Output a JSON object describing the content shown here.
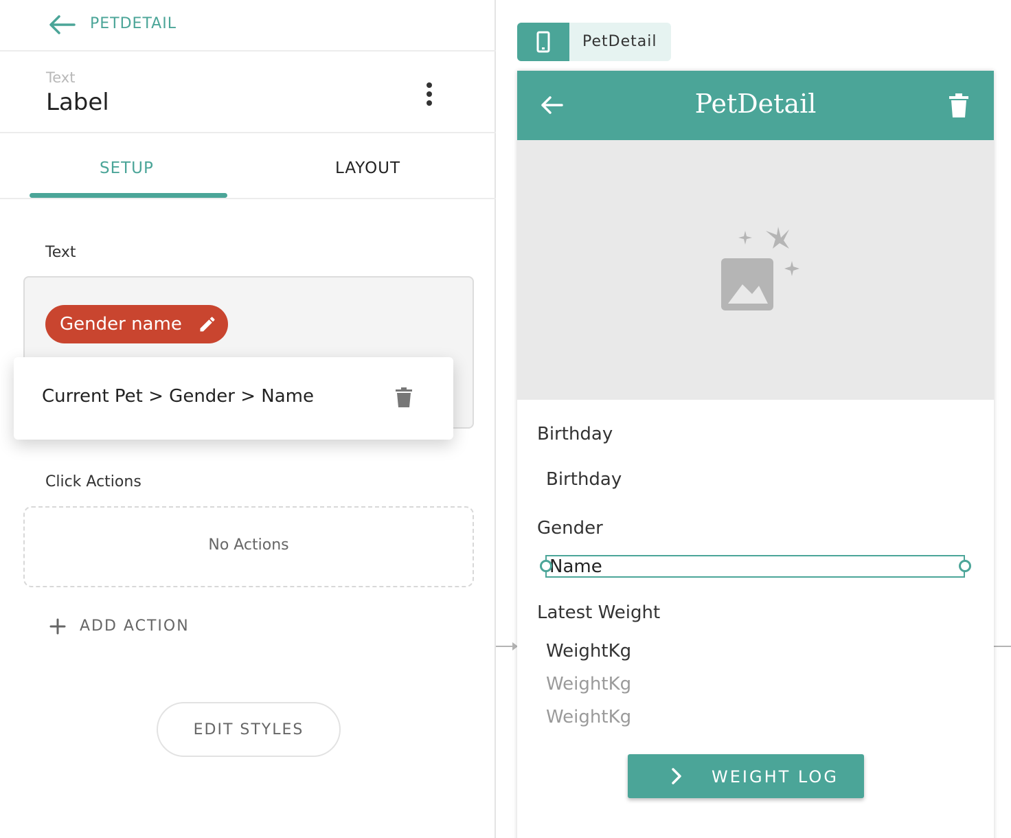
{
  "colors": {
    "accent": "#4ba598",
    "chip": "#c9452f",
    "image_bg": "#e9e9e9"
  },
  "left_panel": {
    "back": {
      "icon": "arrow-left-icon",
      "title": "PETDETAIL"
    },
    "component": {
      "type": "Text",
      "name": "Label",
      "menu_icon": "more-vertical-icon"
    },
    "tabs": [
      {
        "label": "SETUP",
        "active": true
      },
      {
        "label": "LAYOUT",
        "active": false
      }
    ],
    "text_section": {
      "label": "Text",
      "chip": {
        "label": "Gender name",
        "icon": "pencil-icon"
      },
      "binding_path": "Current Pet > Gender > Name",
      "delete_icon": "trash-icon"
    },
    "click_actions": {
      "label": "Click Actions",
      "empty_text": "No Actions",
      "add_label": "ADD ACTION",
      "add_icon": "plus-icon"
    },
    "edit_styles_label": "EDIT STYLES"
  },
  "canvas": {
    "screen_tag": {
      "icon": "phone-icon",
      "label": "PetDetail"
    },
    "appbar": {
      "back_icon": "arrow-left-icon",
      "title": "PetDetail",
      "delete_icon": "trash-icon"
    },
    "image_icon": "image-placeholder-icon",
    "fields": {
      "birthday_label": "Birthday",
      "birthday_value": "Birthday",
      "gender_label": "Gender",
      "gender_value": "Name",
      "weight_label": "Latest Weight",
      "weight_values": [
        "WeightKg",
        "WeightKg",
        "WeightKg"
      ]
    },
    "weight_log_button": {
      "icon": "chevron-right-icon",
      "label": "WEIGHT LOG"
    }
  }
}
